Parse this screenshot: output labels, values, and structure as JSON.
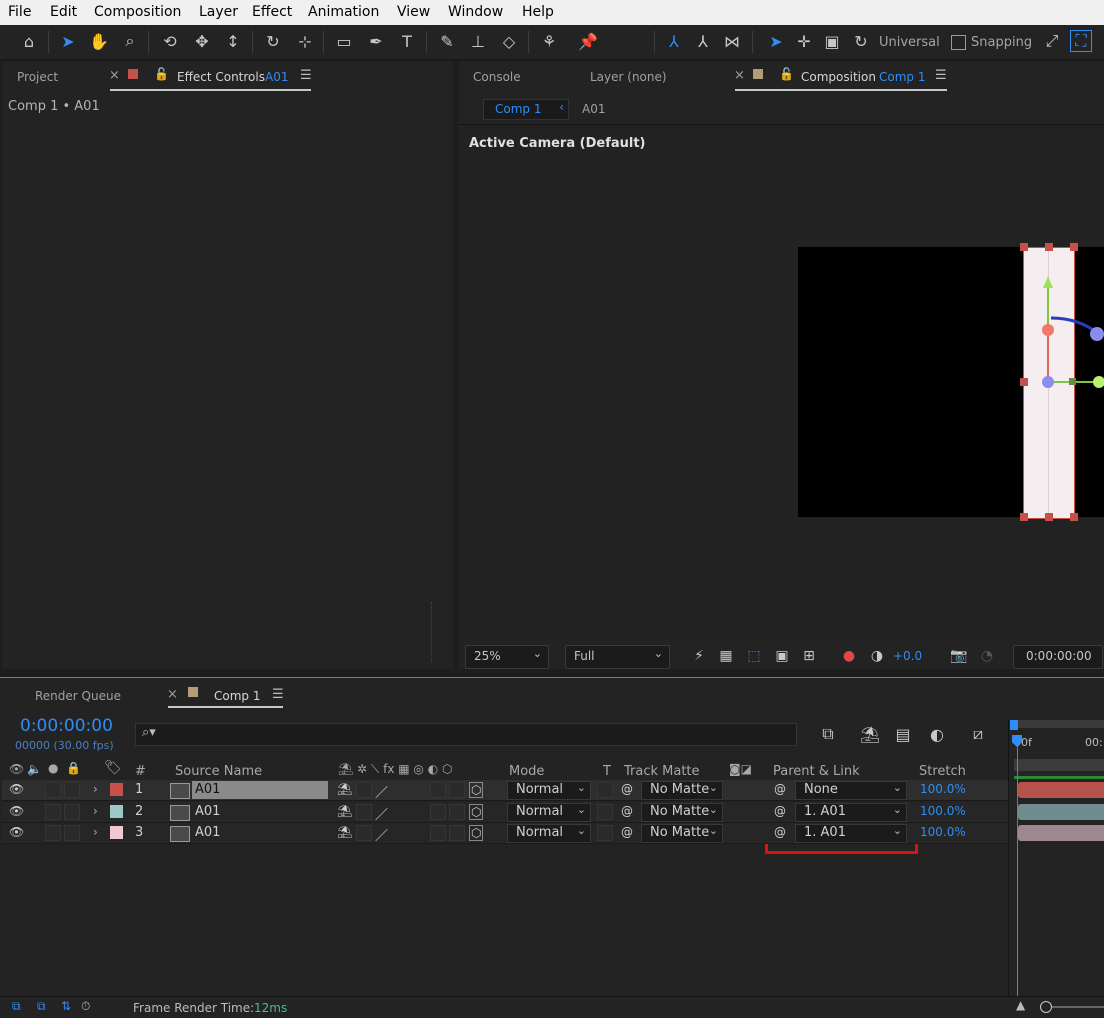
{
  "menu": [
    "File",
    "Edit",
    "Composition",
    "Layer",
    "Effect",
    "Animation",
    "View",
    "Window",
    "Help"
  ],
  "toolbar": {
    "universal_label": "Universal",
    "snapping_label": "Snapping"
  },
  "left_panel": {
    "tab_project": "Project",
    "tab_effect_controls": "Effect Controls",
    "effect_controls_target": "A01",
    "breadcrumb": "Comp 1 • A01",
    "swatch_color": "#c8504a"
  },
  "comp_panel": {
    "tab_console": "Console",
    "tab_layer": "Layer (none)",
    "tab_composition": "Composition",
    "composition_name": "Comp 1",
    "swatch_color": "#b39b7a",
    "subtab_active": "Comp 1",
    "subtab_other": "A01",
    "camera_label": "Active Camera (Default)",
    "zoom": "25%",
    "resolution": "Full",
    "exposure": "+0.0",
    "timecode": "0:00:00:00"
  },
  "timeline": {
    "tab_render_queue": "Render Queue",
    "tab_comp": "Comp 1",
    "timecode": "0:00:00:00",
    "frame_info": "00000 (30.00 fps)",
    "search_placeholder": "",
    "ruler_start": "00f",
    "ruler_next": "00:",
    "columns": {
      "number": "#",
      "source_name": "Source Name",
      "mode": "Mode",
      "t": "T",
      "track_matte": "Track Matte",
      "parent_link": "Parent & Link",
      "stretch": "Stretch"
    },
    "layers": [
      {
        "num": "1",
        "name": "A01",
        "label_color": "#c8504a",
        "mode": "Normal",
        "track_matte": "No Matte",
        "parent": "None",
        "stretch": "100.0%",
        "bar_color": "#b5524c",
        "selected": true
      },
      {
        "num": "2",
        "name": "A01",
        "label_color": "#9ec7c7",
        "mode": "Normal",
        "track_matte": "No Matte",
        "parent": "1. A01",
        "stretch": "100.0%",
        "bar_color": "#6f8c8f",
        "selected": false
      },
      {
        "num": "3",
        "name": "A01",
        "label_color": "#f0c8d4",
        "mode": "Normal",
        "track_matte": "No Matte",
        "parent": "1. A01",
        "stretch": "100.0%",
        "bar_color": "#a08890",
        "selected": false
      }
    ],
    "frame_render_label": "Frame Render Time:",
    "frame_render_value": "12ms"
  }
}
